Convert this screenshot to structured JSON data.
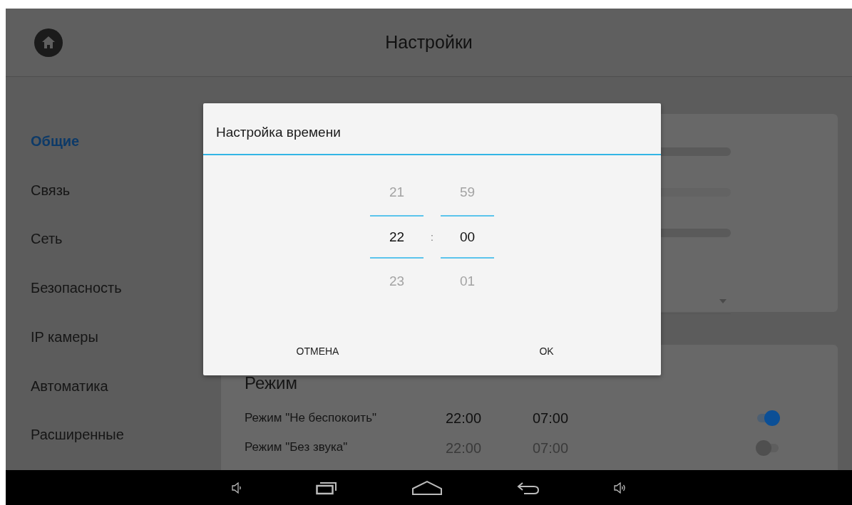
{
  "header": {
    "title": "Настройки"
  },
  "sidebar": {
    "items": [
      {
        "label": "Общие",
        "selected": true
      },
      {
        "label": "Связь",
        "selected": false
      },
      {
        "label": "Сеть",
        "selected": false
      },
      {
        "label": "Безопасность",
        "selected": false
      },
      {
        "label": "IP камеры",
        "selected": false
      },
      {
        "label": "Автоматика",
        "selected": false
      },
      {
        "label": "Расширенные",
        "selected": false
      }
    ]
  },
  "mode_card": {
    "title": "Режим",
    "rows": [
      {
        "label": "Режим \"Не беспокоить\"",
        "start": "22:00",
        "end": "07:00",
        "on": true
      },
      {
        "label": "Режим \"Без звука\"",
        "start": "22:00",
        "end": "07:00",
        "on": false
      }
    ]
  },
  "dialog": {
    "title": "Настройка времени",
    "hours": {
      "previous": "21",
      "current": "22",
      "next": "23"
    },
    "separator": ":",
    "minutes": {
      "previous": "59",
      "current": "00",
      "next": "01"
    },
    "buttons": [
      "ОТМЕНА",
      "OK"
    ]
  }
}
